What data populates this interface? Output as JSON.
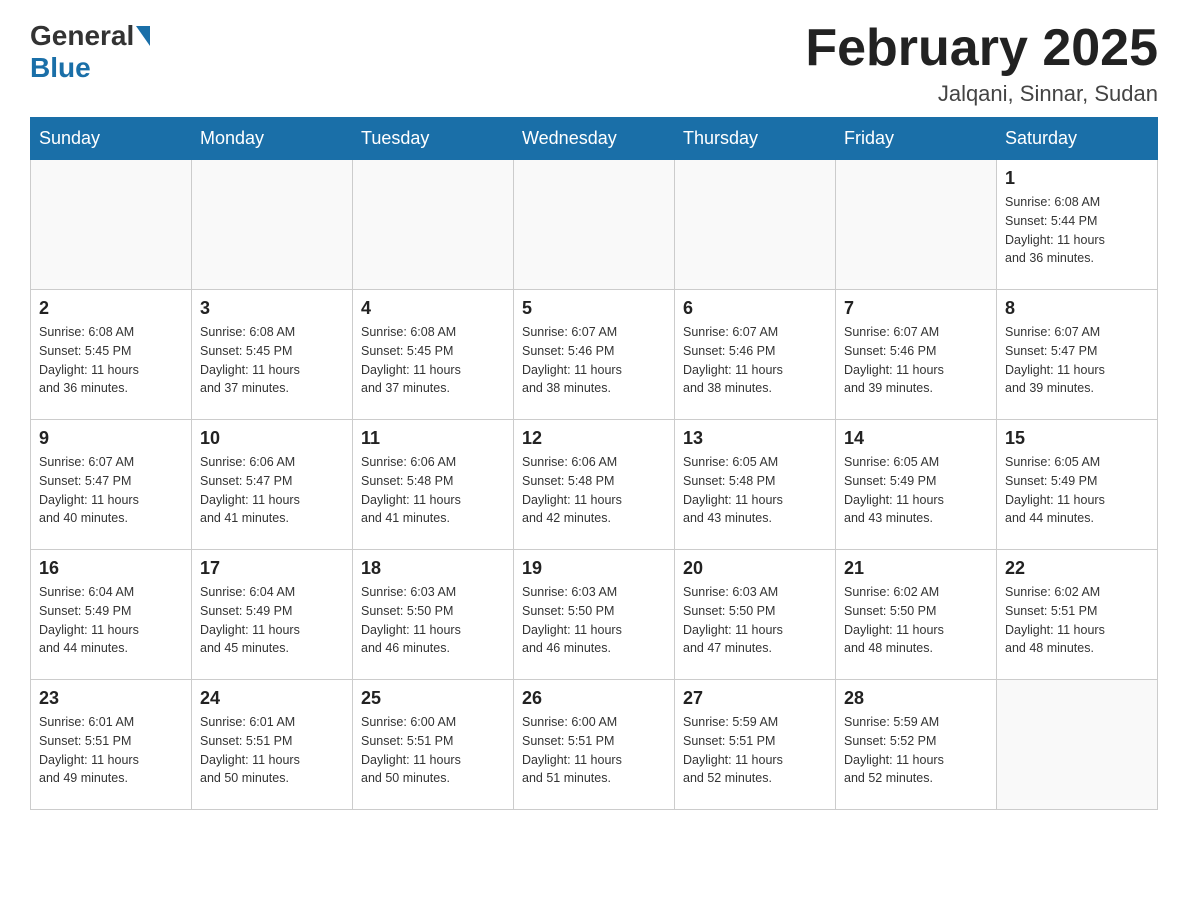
{
  "header": {
    "logo": {
      "general": "General",
      "blue": "Blue"
    },
    "title": "February 2025",
    "location": "Jalqani, Sinnar, Sudan"
  },
  "days_of_week": [
    "Sunday",
    "Monday",
    "Tuesday",
    "Wednesday",
    "Thursday",
    "Friday",
    "Saturday"
  ],
  "weeks": [
    {
      "days": [
        {
          "date": "",
          "info": ""
        },
        {
          "date": "",
          "info": ""
        },
        {
          "date": "",
          "info": ""
        },
        {
          "date": "",
          "info": ""
        },
        {
          "date": "",
          "info": ""
        },
        {
          "date": "",
          "info": ""
        },
        {
          "date": "1",
          "info": "Sunrise: 6:08 AM\nSunset: 5:44 PM\nDaylight: 11 hours\nand 36 minutes."
        }
      ]
    },
    {
      "days": [
        {
          "date": "2",
          "info": "Sunrise: 6:08 AM\nSunset: 5:45 PM\nDaylight: 11 hours\nand 36 minutes."
        },
        {
          "date": "3",
          "info": "Sunrise: 6:08 AM\nSunset: 5:45 PM\nDaylight: 11 hours\nand 37 minutes."
        },
        {
          "date": "4",
          "info": "Sunrise: 6:08 AM\nSunset: 5:45 PM\nDaylight: 11 hours\nand 37 minutes."
        },
        {
          "date": "5",
          "info": "Sunrise: 6:07 AM\nSunset: 5:46 PM\nDaylight: 11 hours\nand 38 minutes."
        },
        {
          "date": "6",
          "info": "Sunrise: 6:07 AM\nSunset: 5:46 PM\nDaylight: 11 hours\nand 38 minutes."
        },
        {
          "date": "7",
          "info": "Sunrise: 6:07 AM\nSunset: 5:46 PM\nDaylight: 11 hours\nand 39 minutes."
        },
        {
          "date": "8",
          "info": "Sunrise: 6:07 AM\nSunset: 5:47 PM\nDaylight: 11 hours\nand 39 minutes."
        }
      ]
    },
    {
      "days": [
        {
          "date": "9",
          "info": "Sunrise: 6:07 AM\nSunset: 5:47 PM\nDaylight: 11 hours\nand 40 minutes."
        },
        {
          "date": "10",
          "info": "Sunrise: 6:06 AM\nSunset: 5:47 PM\nDaylight: 11 hours\nand 41 minutes."
        },
        {
          "date": "11",
          "info": "Sunrise: 6:06 AM\nSunset: 5:48 PM\nDaylight: 11 hours\nand 41 minutes."
        },
        {
          "date": "12",
          "info": "Sunrise: 6:06 AM\nSunset: 5:48 PM\nDaylight: 11 hours\nand 42 minutes."
        },
        {
          "date": "13",
          "info": "Sunrise: 6:05 AM\nSunset: 5:48 PM\nDaylight: 11 hours\nand 43 minutes."
        },
        {
          "date": "14",
          "info": "Sunrise: 6:05 AM\nSunset: 5:49 PM\nDaylight: 11 hours\nand 43 minutes."
        },
        {
          "date": "15",
          "info": "Sunrise: 6:05 AM\nSunset: 5:49 PM\nDaylight: 11 hours\nand 44 minutes."
        }
      ]
    },
    {
      "days": [
        {
          "date": "16",
          "info": "Sunrise: 6:04 AM\nSunset: 5:49 PM\nDaylight: 11 hours\nand 44 minutes."
        },
        {
          "date": "17",
          "info": "Sunrise: 6:04 AM\nSunset: 5:49 PM\nDaylight: 11 hours\nand 45 minutes."
        },
        {
          "date": "18",
          "info": "Sunrise: 6:03 AM\nSunset: 5:50 PM\nDaylight: 11 hours\nand 46 minutes."
        },
        {
          "date": "19",
          "info": "Sunrise: 6:03 AM\nSunset: 5:50 PM\nDaylight: 11 hours\nand 46 minutes."
        },
        {
          "date": "20",
          "info": "Sunrise: 6:03 AM\nSunset: 5:50 PM\nDaylight: 11 hours\nand 47 minutes."
        },
        {
          "date": "21",
          "info": "Sunrise: 6:02 AM\nSunset: 5:50 PM\nDaylight: 11 hours\nand 48 minutes."
        },
        {
          "date": "22",
          "info": "Sunrise: 6:02 AM\nSunset: 5:51 PM\nDaylight: 11 hours\nand 48 minutes."
        }
      ]
    },
    {
      "days": [
        {
          "date": "23",
          "info": "Sunrise: 6:01 AM\nSunset: 5:51 PM\nDaylight: 11 hours\nand 49 minutes."
        },
        {
          "date": "24",
          "info": "Sunrise: 6:01 AM\nSunset: 5:51 PM\nDaylight: 11 hours\nand 50 minutes."
        },
        {
          "date": "25",
          "info": "Sunrise: 6:00 AM\nSunset: 5:51 PM\nDaylight: 11 hours\nand 50 minutes."
        },
        {
          "date": "26",
          "info": "Sunrise: 6:00 AM\nSunset: 5:51 PM\nDaylight: 11 hours\nand 51 minutes."
        },
        {
          "date": "27",
          "info": "Sunrise: 5:59 AM\nSunset: 5:51 PM\nDaylight: 11 hours\nand 52 minutes."
        },
        {
          "date": "28",
          "info": "Sunrise: 5:59 AM\nSunset: 5:52 PM\nDaylight: 11 hours\nand 52 minutes."
        },
        {
          "date": "",
          "info": ""
        }
      ]
    }
  ]
}
